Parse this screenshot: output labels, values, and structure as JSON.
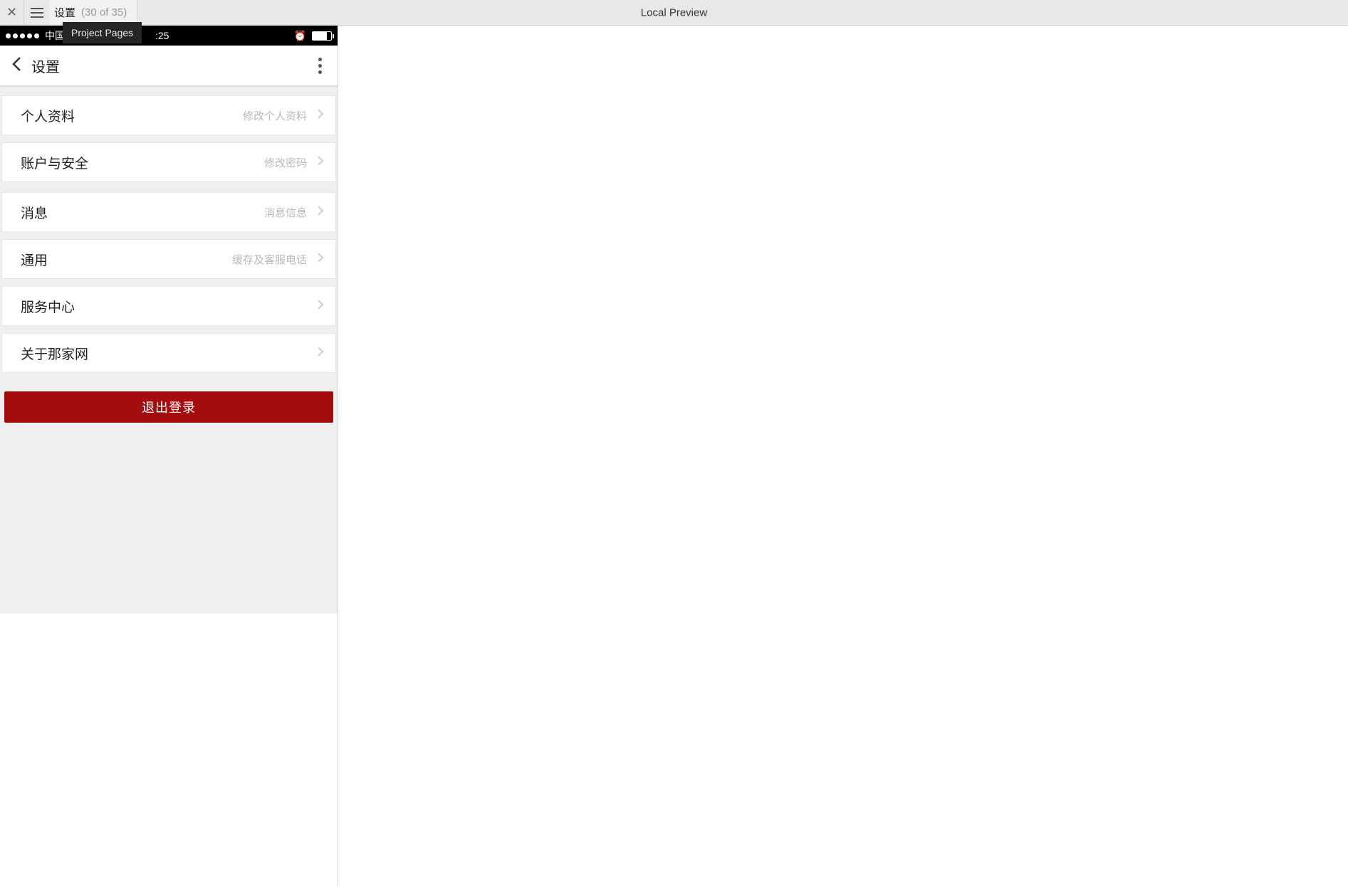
{
  "toolbar": {
    "tab_title": "设置",
    "tab_count": "(30 of 35)",
    "center_label": "Local Preview",
    "tooltip": "Project Pages"
  },
  "phone": {
    "status": {
      "carrier": "中国",
      "time": ":25"
    },
    "nav": {
      "title": "设置"
    },
    "items": [
      {
        "label": "个人资料",
        "hint": "修改个人资料"
      },
      {
        "label": "账户与安全",
        "hint": "修改密码"
      },
      {
        "label": "消息",
        "hint": "消息信息"
      },
      {
        "label": "通用",
        "hint": "缓存及客服电话"
      },
      {
        "label": "服务中心",
        "hint": ""
      },
      {
        "label": "关于那家网",
        "hint": ""
      }
    ],
    "logout_label": "退出登录"
  }
}
